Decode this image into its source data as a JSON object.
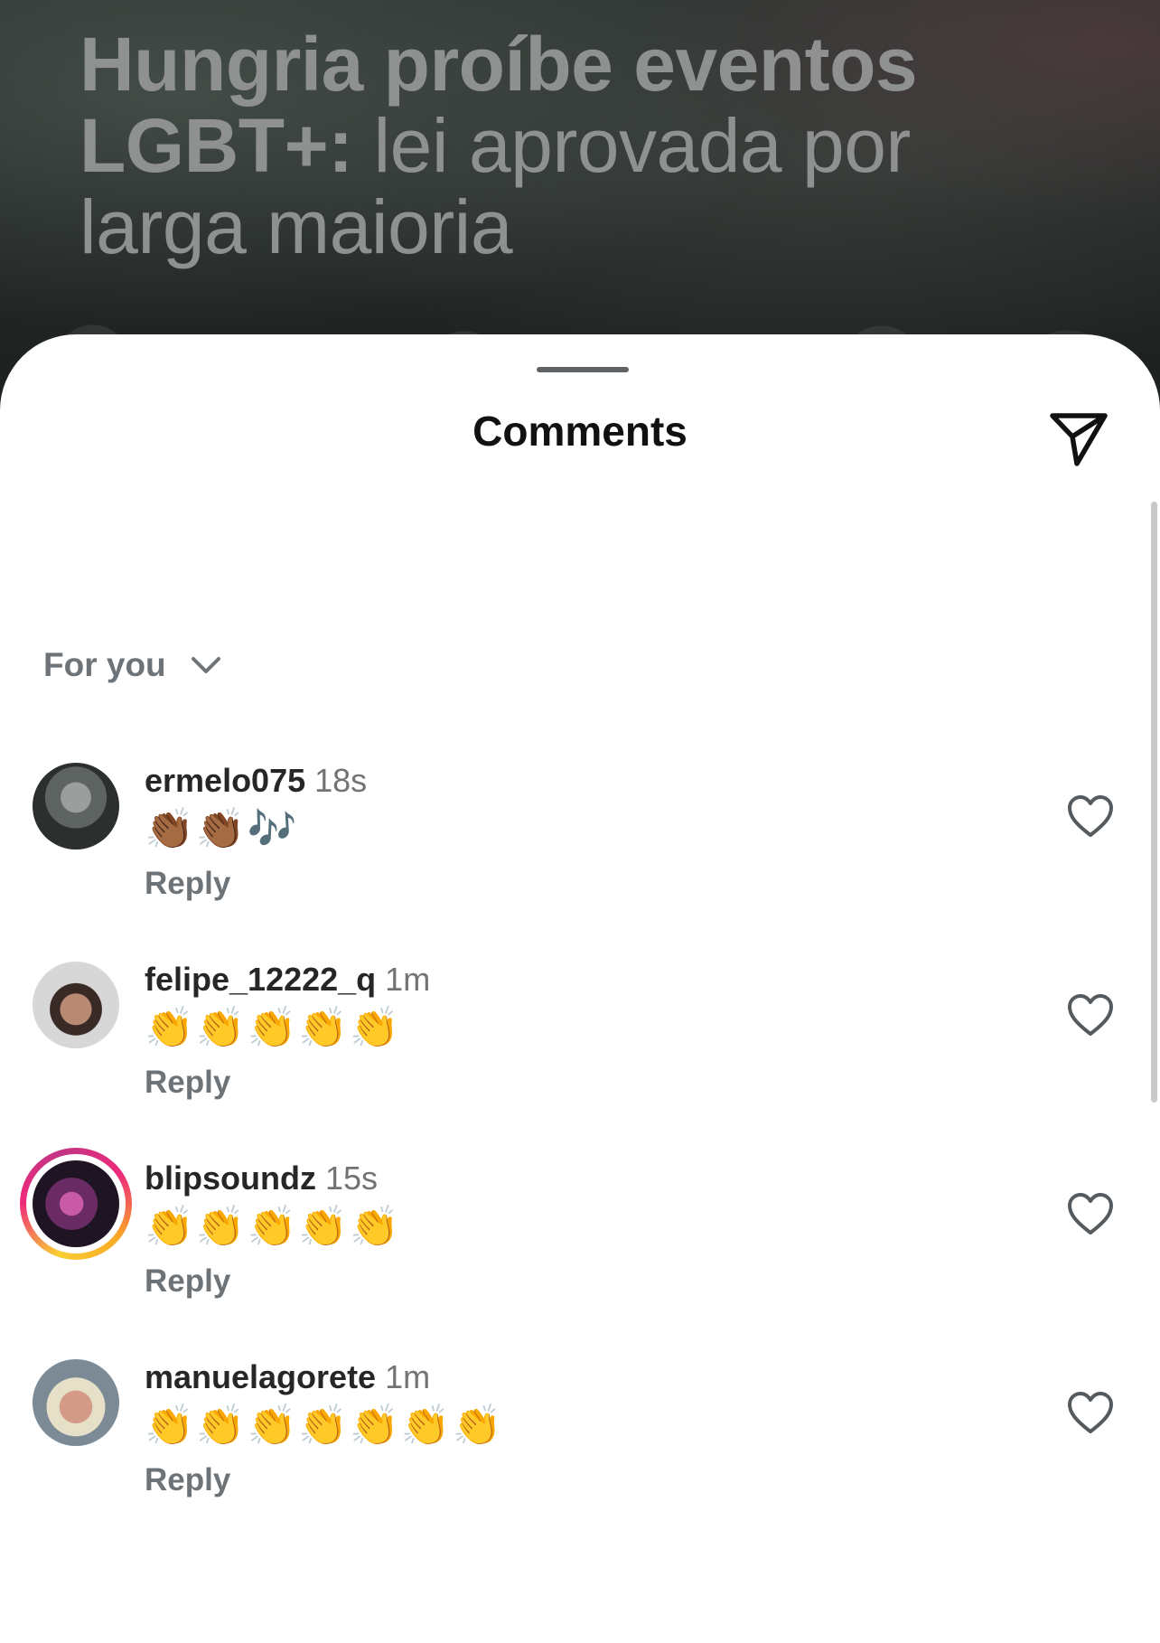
{
  "post": {
    "headline_bold": "Hungria proíbe eventos LGBT+:",
    "headline_rest": "lei aprovada por larga maioria"
  },
  "sheet": {
    "title": "Comments",
    "sort_label": "For you"
  },
  "icons": {
    "share": "paper-plane-icon",
    "sort": "chevron-down-icon",
    "like": "heart-outline-icon"
  },
  "comments": [
    {
      "username": "ermelo075",
      "time": "18s",
      "text": "👏🏾👏🏾🎶",
      "reply_label": "Reply",
      "has_story_ring": false
    },
    {
      "username": "felipe_12222_q",
      "time": "1m",
      "text": "👏👏👏👏👏",
      "reply_label": "Reply",
      "has_story_ring": false
    },
    {
      "username": "blipsoundz",
      "time": "15s",
      "text": "👏👏👏👏👏",
      "reply_label": "Reply",
      "has_story_ring": true
    },
    {
      "username": "manuelagorete",
      "time": "1m",
      "text": "👏👏👏👏👏👏👏",
      "reply_label": "Reply",
      "has_story_ring": false
    }
  ]
}
